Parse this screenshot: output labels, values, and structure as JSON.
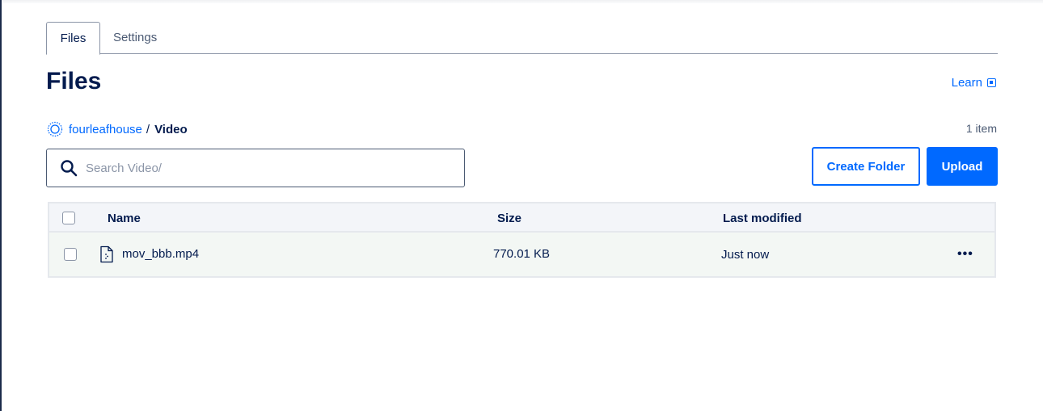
{
  "tabs": [
    {
      "label": "Files"
    },
    {
      "label": "Settings"
    }
  ],
  "page_title": "Files",
  "learn_label": "Learn",
  "breadcrumb": {
    "bucket": "fourleafhouse",
    "separator": "/",
    "current": "Video"
  },
  "item_count": "1 item",
  "search": {
    "placeholder": "Search Video/"
  },
  "buttons": {
    "create_folder": "Create Folder",
    "upload": "Upload"
  },
  "table": {
    "columns": [
      "Name",
      "Size",
      "Last modified"
    ],
    "rows": [
      {
        "name": "mov_bbb.mp4",
        "size": "770.01 KB",
        "modified": "Just now"
      }
    ]
  },
  "colors": {
    "accent": "#0069ff",
    "text": "#031b4e"
  }
}
